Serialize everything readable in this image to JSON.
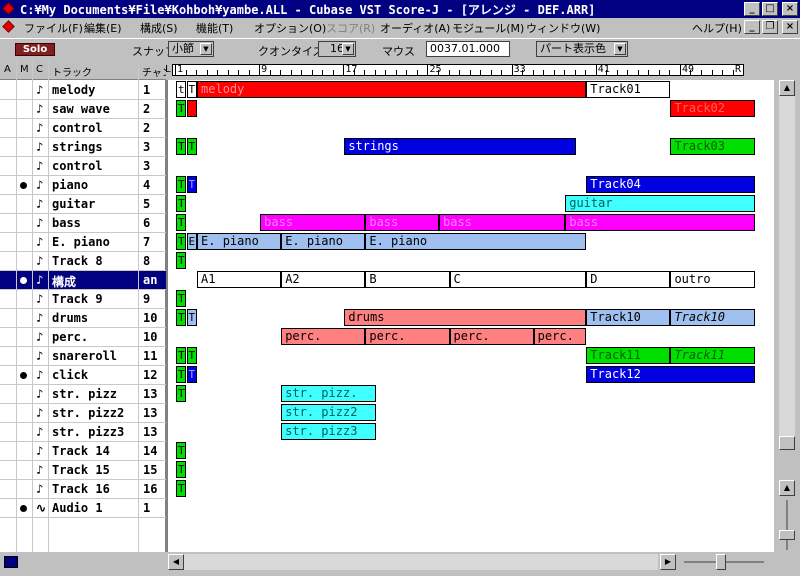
{
  "window": {
    "title": "C:¥My Documents¥File¥Kohboh¥yambe.ALL - Cubase VST Score-J - [アレンジ - DEF.ARR]",
    "controls": {
      "minimize": "_",
      "maximize": "□",
      "close": "×"
    },
    "doc_controls": {
      "minimize": "_",
      "restore": "❐",
      "close": "×"
    }
  },
  "menu": {
    "items": [
      "ファイル(F)",
      "編集(E)",
      "構成(S)",
      "機能(T)",
      "オプション(O)",
      "スコア(R)",
      "オーディオ(A)",
      "モジュール(M)",
      "ウィンドウ(W)"
    ],
    "help": "ヘルプ(H)"
  },
  "toolbar": {
    "solo": "Solo",
    "snap_label": "スナップ",
    "snap_value": "小節",
    "quantize_label": "クオンタイズ",
    "quantize_value": "16",
    "mouse_label": "マウス",
    "mouse_value": "0037.01.000",
    "part_display_value": "パート表示色"
  },
  "tracklist": {
    "headers": {
      "a": "A",
      "m": "M",
      "c": "C",
      "track": "トラック",
      "chan": "チャン"
    },
    "rows": [
      {
        "name": "melody",
        "chan": "1",
        "sym": "♪",
        "dot": false,
        "sel": false
      },
      {
        "name": "saw wave",
        "chan": "2",
        "sym": "♪",
        "dot": false,
        "sel": false
      },
      {
        "name": "control",
        "chan": "2",
        "sym": "♪",
        "dot": false,
        "sel": false
      },
      {
        "name": "strings",
        "chan": "3",
        "sym": "♪",
        "dot": false,
        "sel": false
      },
      {
        "name": "control",
        "chan": "3",
        "sym": "♪",
        "dot": false,
        "sel": false
      },
      {
        "name": "piano",
        "chan": "4",
        "sym": "♪",
        "dot": true,
        "sel": false
      },
      {
        "name": "guitar",
        "chan": "5",
        "sym": "♪",
        "dot": false,
        "sel": false
      },
      {
        "name": "bass",
        "chan": "6",
        "sym": "♪",
        "dot": false,
        "sel": false
      },
      {
        "name": "E. piano",
        "chan": "7",
        "sym": "♪",
        "dot": false,
        "sel": false
      },
      {
        "name": "Track 8",
        "chan": "8",
        "sym": "♪",
        "dot": false,
        "sel": false
      },
      {
        "name": "構成",
        "chan": "an",
        "sym": "♪",
        "dot": true,
        "sel": true
      },
      {
        "name": "Track 9",
        "chan": "9",
        "sym": "♪",
        "dot": false,
        "sel": false
      },
      {
        "name": "drums",
        "chan": "10",
        "sym": "♪",
        "dot": false,
        "sel": false
      },
      {
        "name": "perc.",
        "chan": "10",
        "sym": "♪",
        "dot": false,
        "sel": false
      },
      {
        "name": "snareroll",
        "chan": "11",
        "sym": "♪",
        "dot": false,
        "sel": false
      },
      {
        "name": "click",
        "chan": "12",
        "sym": "♪",
        "dot": true,
        "sel": false
      },
      {
        "name": "str. pizz",
        "chan": "13",
        "sym": "♪",
        "dot": false,
        "sel": false
      },
      {
        "name": "str. pizz2",
        "chan": "13",
        "sym": "♪",
        "dot": false,
        "sel": false
      },
      {
        "name": "str. pizz3",
        "chan": "13",
        "sym": "♪",
        "dot": false,
        "sel": false
      },
      {
        "name": "Track 14",
        "chan": "14",
        "sym": "♪",
        "dot": false,
        "sel": false
      },
      {
        "name": "Track 15",
        "chan": "15",
        "sym": "♪",
        "dot": false,
        "sel": false
      },
      {
        "name": "Track 16",
        "chan": "16",
        "sym": "♪",
        "dot": false,
        "sel": false
      },
      {
        "name": "Audio 1",
        "chan": "1",
        "sym": "∿",
        "dot": true,
        "sel": false
      }
    ]
  },
  "ruler": {
    "marks": [
      "1",
      "9",
      "17",
      "25",
      "33",
      "41",
      "49"
    ],
    "start_marker": "L",
    "end_marker": "R"
  },
  "colors": {
    "red": "#ff0000",
    "green": "#00e000",
    "blue": "#0000e0",
    "cyan": "#40ffff",
    "magenta": "#ff00ff",
    "lightblue": "#a0c0f0",
    "salmon": "#ff8080",
    "white": "#ffffff"
  },
  "parts": [
    {
      "row": 0,
      "bar": 1,
      "len": 0,
      "label": "t",
      "color": "white"
    },
    {
      "row": 0,
      "bar": 2,
      "len": 0,
      "label": "T",
      "color": "white"
    },
    {
      "row": 0,
      "bar": 3,
      "len": 37,
      "label": "melody",
      "color": "red"
    },
    {
      "row": 0,
      "bar": 40,
      "len": 8,
      "label": "Track01",
      "color": "white"
    },
    {
      "row": 1,
      "bar": 1,
      "len": 0,
      "label": "T",
      "color": "green"
    },
    {
      "row": 1,
      "bar": 2,
      "len": 0,
      "label": "",
      "color": "red"
    },
    {
      "row": 1,
      "bar": 48,
      "len": 8,
      "label": "Track02",
      "color": "red"
    },
    {
      "row": 3,
      "bar": 1,
      "len": 0,
      "label": "T",
      "color": "green"
    },
    {
      "row": 3,
      "bar": 2,
      "len": 0,
      "label": "T",
      "color": "green"
    },
    {
      "row": 3,
      "bar": 17,
      "len": 22,
      "label": "strings",
      "color": "blue"
    },
    {
      "row": 3,
      "bar": 48,
      "len": 8,
      "label": "Track03",
      "color": "green"
    },
    {
      "row": 5,
      "bar": 1,
      "len": 0,
      "label": "T",
      "color": "green"
    },
    {
      "row": 5,
      "bar": 2,
      "len": 0,
      "label": "T",
      "color": "blue"
    },
    {
      "row": 5,
      "bar": 40,
      "len": 16,
      "label": "Track04",
      "color": "blue"
    },
    {
      "row": 6,
      "bar": 1,
      "len": 0,
      "label": "T",
      "color": "green"
    },
    {
      "row": 6,
      "bar": 38,
      "len": 18,
      "label": "guitar",
      "color": "cyan"
    },
    {
      "row": 7,
      "bar": 1,
      "len": 0,
      "label": "T",
      "color": "green"
    },
    {
      "row": 7,
      "bar": 9,
      "len": 10,
      "label": "bass",
      "color": "magenta"
    },
    {
      "row": 7,
      "bar": 19,
      "len": 7,
      "label": "bass",
      "color": "magenta"
    },
    {
      "row": 7,
      "bar": 26,
      "len": 12,
      "label": "bass",
      "color": "magenta"
    },
    {
      "row": 7,
      "bar": 38,
      "len": 18,
      "label": "bass",
      "color": "magenta"
    },
    {
      "row": 8,
      "bar": 1,
      "len": 0,
      "label": "T",
      "color": "green"
    },
    {
      "row": 8,
      "bar": 2,
      "len": 0,
      "label": "E",
      "color": "lightblue"
    },
    {
      "row": 8,
      "bar": 3,
      "len": 8,
      "label": "E. piano",
      "color": "lightblue"
    },
    {
      "row": 8,
      "bar": 11,
      "len": 8,
      "label": "E. piano",
      "color": "lightblue"
    },
    {
      "row": 8,
      "bar": 19,
      "len": 21,
      "label": "E. piano",
      "color": "lightblue"
    },
    {
      "row": 9,
      "bar": 1,
      "len": 0,
      "label": "T",
      "color": "green"
    },
    {
      "row": 10,
      "bar": 3,
      "len": 8,
      "label": "A1",
      "color": "white"
    },
    {
      "row": 10,
      "bar": 11,
      "len": 8,
      "label": "A2",
      "color": "white"
    },
    {
      "row": 10,
      "bar": 19,
      "len": 8,
      "label": "B",
      "color": "white"
    },
    {
      "row": 10,
      "bar": 27,
      "len": 13,
      "label": "C",
      "color": "white"
    },
    {
      "row": 10,
      "bar": 40,
      "len": 8,
      "label": "D",
      "color": "white"
    },
    {
      "row": 10,
      "bar": 48,
      "len": 8,
      "label": "outro",
      "color": "white"
    },
    {
      "row": 11,
      "bar": 1,
      "len": 0,
      "label": "T",
      "color": "green"
    },
    {
      "row": 12,
      "bar": 1,
      "len": 0,
      "label": "T",
      "color": "green"
    },
    {
      "row": 12,
      "bar": 2,
      "len": 0,
      "label": "T",
      "color": "lightblue"
    },
    {
      "row": 12,
      "bar": 17,
      "len": 23,
      "label": "drums",
      "color": "salmon"
    },
    {
      "row": 12,
      "bar": 40,
      "len": 8,
      "label": "Track10",
      "color": "lightblue"
    },
    {
      "row": 12,
      "bar": 48,
      "len": 8,
      "label": "Track10",
      "color": "lightblue",
      "italic": true
    },
    {
      "row": 13,
      "bar": 11,
      "len": 8,
      "label": "perc.",
      "color": "salmon"
    },
    {
      "row": 13,
      "bar": 19,
      "len": 8,
      "label": "perc.",
      "color": "salmon"
    },
    {
      "row": 13,
      "bar": 27,
      "len": 8,
      "label": "perc.",
      "color": "salmon"
    },
    {
      "row": 13,
      "bar": 35,
      "len": 5,
      "label": "perc.",
      "color": "salmon"
    },
    {
      "row": 14,
      "bar": 1,
      "len": 0,
      "label": "T",
      "color": "green"
    },
    {
      "row": 14,
      "bar": 2,
      "len": 0,
      "label": "T",
      "color": "green"
    },
    {
      "row": 14,
      "bar": 40,
      "len": 8,
      "label": "Track11",
      "color": "green"
    },
    {
      "row": 14,
      "bar": 48,
      "len": 8,
      "label": "Track11",
      "color": "green",
      "italic": true
    },
    {
      "row": 15,
      "bar": 1,
      "len": 0,
      "label": "T",
      "color": "green"
    },
    {
      "row": 15,
      "bar": 2,
      "len": 0,
      "label": "T",
      "color": "blue"
    },
    {
      "row": 15,
      "bar": 40,
      "len": 16,
      "label": "Track12",
      "color": "blue"
    },
    {
      "row": 16,
      "bar": 1,
      "len": 0,
      "label": "T",
      "color": "green"
    },
    {
      "row": 16,
      "bar": 11,
      "len": 9,
      "label": "str. pizz.",
      "color": "cyan"
    },
    {
      "row": 17,
      "bar": 11,
      "len": 9,
      "label": "str. pizz2",
      "color": "cyan"
    },
    {
      "row": 18,
      "bar": 11,
      "len": 9,
      "label": "str. pizz3",
      "color": "cyan"
    },
    {
      "row": 19,
      "bar": 1,
      "len": 0,
      "label": "T",
      "color": "green"
    },
    {
      "row": 20,
      "bar": 1,
      "len": 0,
      "label": "T",
      "color": "green"
    },
    {
      "row": 21,
      "bar": 1,
      "len": 0,
      "label": "T",
      "color": "green"
    }
  ],
  "icons": {
    "app": "cubase-diamond-icon",
    "status": "status-icon"
  }
}
